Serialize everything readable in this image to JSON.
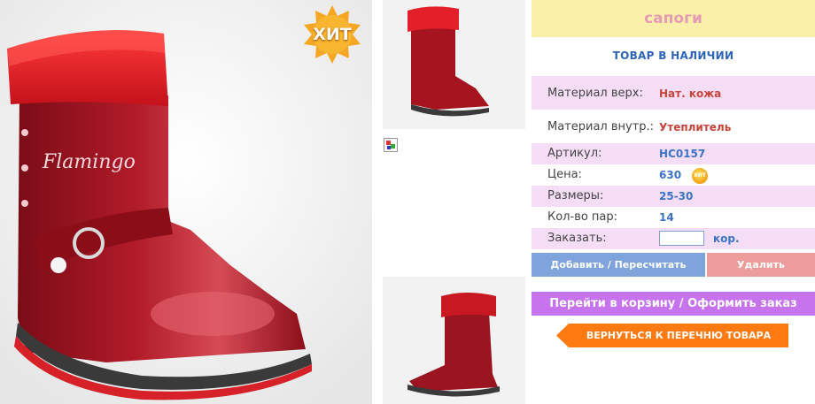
{
  "product": {
    "title": "сапоги",
    "availability": "ТОВАР В НАЛИЧИИ",
    "hit_badge": "ХИТ",
    "brand_text": "Flamingo"
  },
  "specs": [
    {
      "label": "Материал верх:",
      "value": "Нат. кожа"
    },
    {
      "label": "Материал внутр.:",
      "value": "Утеплитель"
    },
    {
      "label": "Артикул:",
      "value": "НС0157"
    },
    {
      "label": "Цена:",
      "value": "630"
    },
    {
      "label": "Размеры:",
      "value": "25-30"
    },
    {
      "label": "Кол-во пар:",
      "value": "14"
    }
  ],
  "order": {
    "label": "Заказать:",
    "quantity_value": "",
    "unit": "кор."
  },
  "buttons": {
    "add": "Добавить / Пересчитать",
    "delete": "Удалить",
    "cart": "Перейти в корзину / Оформить заказ",
    "back": "ВЕРНУТЬСЯ К ПЕРЕЧНЮ ТОВАРА"
  },
  "colors": {
    "title_bg": "#f9f1a9",
    "title_text": "#e79ab3",
    "row_pink": "#f5def5",
    "accent_blue": "#3b74c6",
    "accent_red": "#c8453c",
    "add_button": "#7fa3db",
    "delete_button": "#ed9c9c",
    "cart_button": "#c773ee",
    "back_button": "#ff7a10"
  }
}
